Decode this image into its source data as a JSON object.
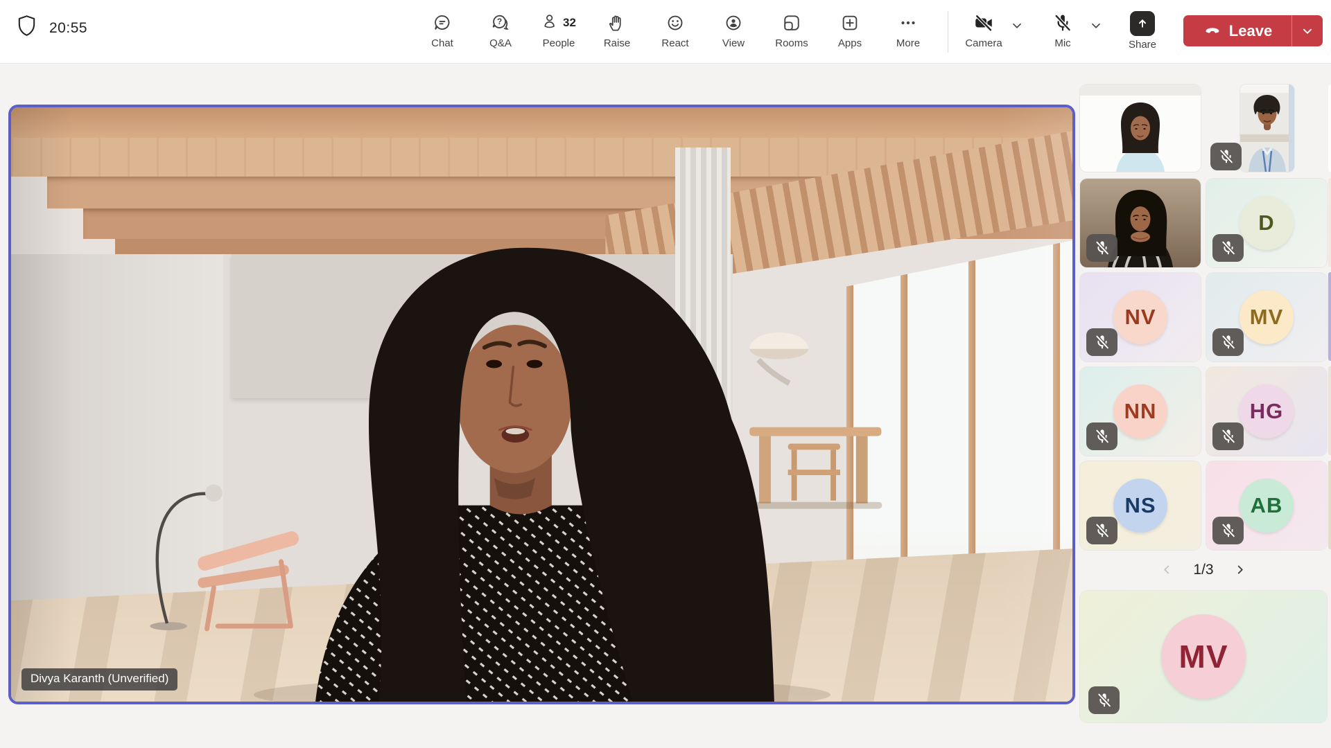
{
  "window": {
    "timer": "20:55"
  },
  "toolbar": {
    "items": [
      {
        "id": "chat",
        "label": "Chat"
      },
      {
        "id": "qa",
        "label": "Q&A"
      },
      {
        "id": "people",
        "label": "People",
        "count": "32"
      },
      {
        "id": "raise",
        "label": "Raise"
      },
      {
        "id": "react",
        "label": "React"
      },
      {
        "id": "view",
        "label": "View"
      },
      {
        "id": "rooms",
        "label": "Rooms"
      },
      {
        "id": "apps",
        "label": "Apps"
      },
      {
        "id": "more",
        "label": "More"
      }
    ],
    "camera": {
      "label": "Camera",
      "state": "off"
    },
    "mic": {
      "label": "Mic",
      "state": "muted"
    },
    "share": {
      "label": "Share"
    },
    "leave": {
      "label": "Leave"
    }
  },
  "stage": {
    "speaker_name": "Divya Karanth (Unverified)",
    "active_border_color": "#5B5FC7"
  },
  "sidebar": {
    "pagination": {
      "current_page": "1/3"
    },
    "tiles": [
      {
        "kind": "video",
        "person": "woman-on-white",
        "muted": false
      },
      {
        "kind": "video",
        "person": "man-portrait",
        "muted": true
      },
      {
        "kind": "video",
        "person": "woman-arms-crossed",
        "muted": true
      },
      {
        "kind": "avatar",
        "initials": "D",
        "muted": true,
        "avatar_bg": "#e9ecdb",
        "avatar_fg": "#4c5a1f",
        "tile_from": "#e1efe8",
        "tile_to": "#f2f4ef"
      },
      {
        "kind": "avatar",
        "initials": "NV",
        "muted": true,
        "avatar_bg": "#f8d8cb",
        "avatar_fg": "#9c3a1f",
        "tile_from": "#e7e1f3",
        "tile_to": "#f2ecf0"
      },
      {
        "kind": "avatar",
        "initials": "MV",
        "muted": true,
        "avatar_bg": "#fce9c8",
        "avatar_fg": "#8d6a1d",
        "tile_from": "#e1ecec",
        "tile_to": "#f1eef2"
      },
      {
        "kind": "avatar",
        "initials": "NN",
        "muted": true,
        "avatar_bg": "#f9d3c7",
        "avatar_fg": "#a03b22",
        "tile_from": "#dcefed",
        "tile_to": "#f3efe7"
      },
      {
        "kind": "avatar",
        "initials": "HG",
        "muted": true,
        "avatar_bg": "#efd9e8",
        "avatar_fg": "#7b2c5f",
        "tile_from": "#f1e8de",
        "tile_to": "#e7e5f1"
      },
      {
        "kind": "avatar",
        "initials": "NS",
        "muted": true,
        "avatar_bg": "#c2d4ee",
        "avatar_fg": "#1a3a66",
        "tile_from": "#f5eeda",
        "tile_to": "#f4eee0"
      },
      {
        "kind": "avatar",
        "initials": "AB",
        "muted": true,
        "avatar_bg": "#c9ead6",
        "avatar_fg": "#20703c",
        "tile_from": "#f9dfe8",
        "tile_to": "#f3e9ef"
      }
    ],
    "spotlight": {
      "kind": "avatar",
      "initials": "MV",
      "muted": true,
      "avatar_bg": "#f6ced6",
      "avatar_fg": "#8e2436",
      "tile_from": "#eff0d8",
      "tile_to": "#def0e8"
    }
  },
  "colors": {
    "leave_red": "#C53C44",
    "badge_bg": "#575351",
    "toolbar_icon": "#424242",
    "active_border": "#5B5FC7"
  }
}
